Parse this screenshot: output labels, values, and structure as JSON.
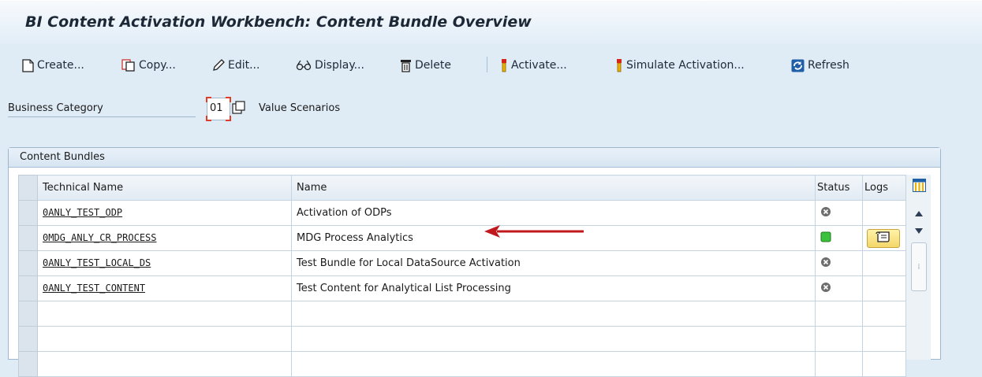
{
  "window": {
    "title": "BI Content Activation Workbench: Content Bundle Overview"
  },
  "toolbar": {
    "create": "Create...",
    "copy": "Copy...",
    "edit": "Edit...",
    "display": "Display...",
    "delete": "Delete",
    "activate": "Activate...",
    "simulate": "Simulate Activation...",
    "refresh": "Refresh"
  },
  "business_category": {
    "label": "Business Category",
    "value": "01",
    "description": "Value Scenarios"
  },
  "content_bundles": {
    "title": "Content Bundles",
    "columns": {
      "technical_name": "Technical Name",
      "name": "Name",
      "status": "Status",
      "logs": "Logs"
    },
    "rows": [
      {
        "technical_name": "0ANLY_TEST_ODP",
        "name": "Activation of ODPs",
        "status": "inactive",
        "has_log": false
      },
      {
        "technical_name": "0MDG_ANLY_CR_PROCESS",
        "name": "MDG Process Analytics",
        "status": "active",
        "has_log": true
      },
      {
        "technical_name": "0ANLY_TEST_LOCAL_DS",
        "name": "Test Bundle for Local DataSource Activation",
        "status": "inactive",
        "has_log": false
      },
      {
        "technical_name": "0ANLY_TEST_CONTENT",
        "name": "Test Content for Analytical List Processing",
        "status": "inactive",
        "has_log": false
      }
    ]
  },
  "colors": {
    "background": "#dfebf5",
    "status_active": "#3cc13c",
    "status_inactive": "#6d6d6d",
    "arrow": "#c0181c",
    "log_button": "#f3d76a"
  }
}
